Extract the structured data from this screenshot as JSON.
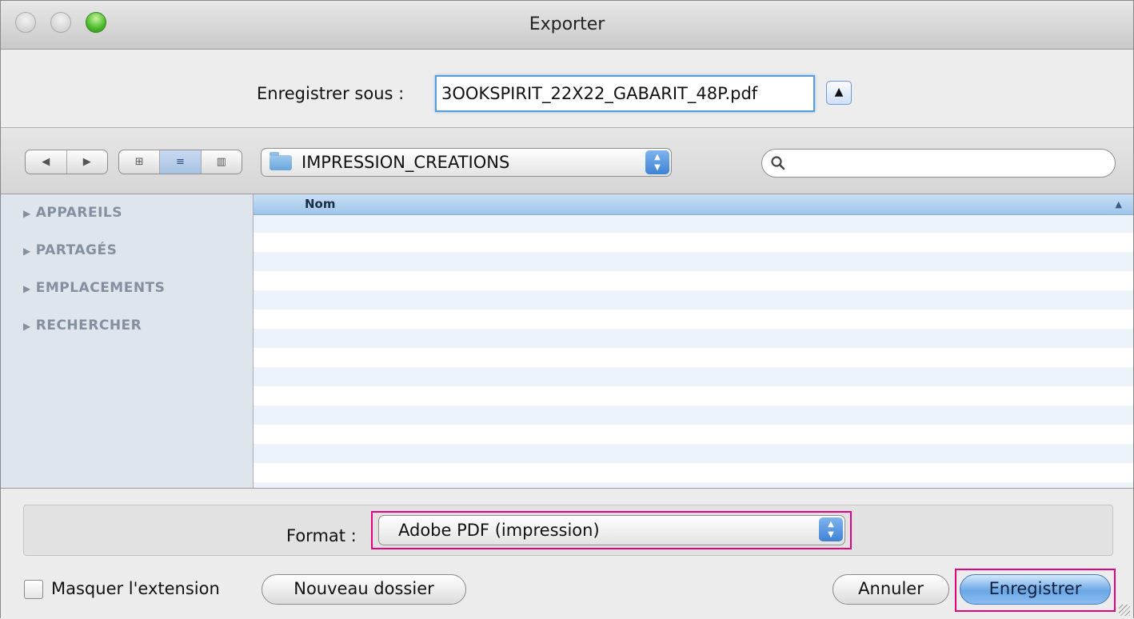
{
  "window": {
    "title": "Exporter"
  },
  "save_as": {
    "label": "Enregistrer sous :",
    "filename": "3OOKSPIRIT_22X22_GABARIT_48P.pdf",
    "expand_glyph": "▲"
  },
  "toolbar": {
    "back_glyph": "◀",
    "forward_glyph": "▶",
    "view_icon_glyph": "⊞",
    "view_list_glyph": "≡",
    "view_column_glyph": "▥",
    "folder": "IMPRESSION_CREATIONS",
    "search": {
      "placeholder": "",
      "value": ""
    }
  },
  "sidebar": {
    "items": [
      {
        "label": "APPAREILS"
      },
      {
        "label": "PARTAGÉS"
      },
      {
        "label": "EMPLACEMENTS"
      },
      {
        "label": "RECHERCHER"
      }
    ]
  },
  "file_list": {
    "column_header": "Nom",
    "sort_glyph": "▲",
    "rows": []
  },
  "format": {
    "label": "Format :",
    "selected": "Adobe PDF (impression)"
  },
  "footer": {
    "hide_extension_label": "Masquer l'extension",
    "hide_extension_checked": false,
    "new_folder_label": "Nouveau dossier",
    "cancel_label": "Annuler",
    "save_label": "Enregistrer"
  },
  "colors": {
    "highlight": "#e6007e",
    "accent": "#5b9bd8"
  }
}
